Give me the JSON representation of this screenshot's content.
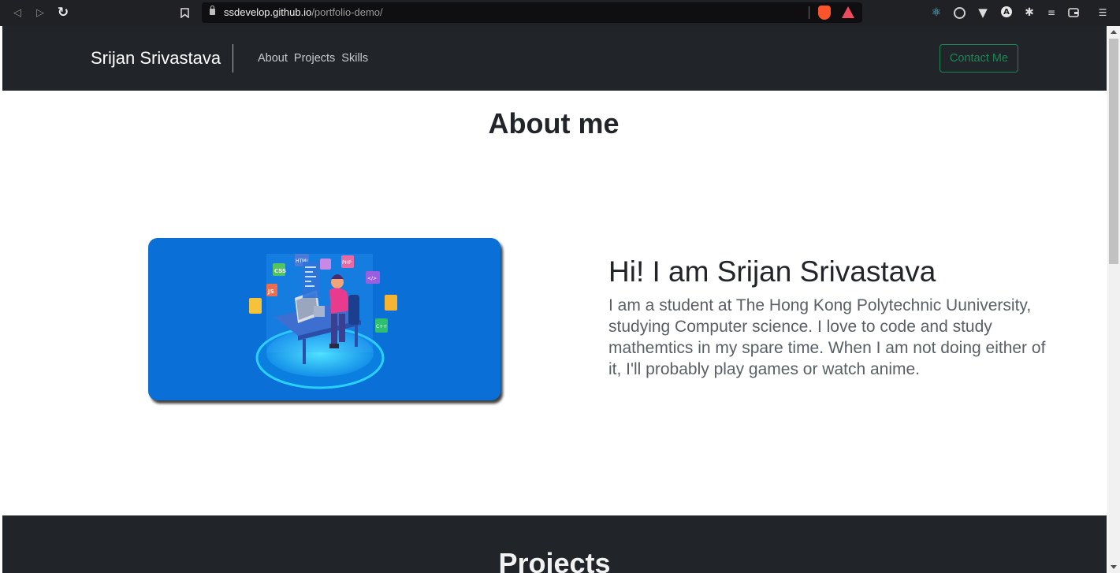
{
  "browser": {
    "url_host": "ssdevelop.github.io",
    "url_path": "/portfolio-demo/",
    "back_icon": "back-arrow-icon",
    "forward_icon": "forward-arrow-icon",
    "reload_icon": "reload-icon",
    "extensions": [
      "react-devtools-icon",
      "target-icon",
      "vue-icon",
      "a-badge-icon",
      "puzzle-icon",
      "reading-list-icon",
      "wallet-icon",
      "menu-icon"
    ]
  },
  "navbar": {
    "brand": "Srijan Srivastava",
    "links": [
      "About",
      "Projects",
      "Skills"
    ],
    "contact_label": "Contact Me",
    "accent_color": "#198754",
    "background": "#212529"
  },
  "about": {
    "title": "About me",
    "greeting": "Hi! I am Srijan Srivastava",
    "bio": "I am a student at The Hong Kong Polytechnic Uuniversity, studying Computer science. I love to code and study mathemtics in my spare time. When I am not doing either of it, I'll probably play games or watch anime.",
    "image_tags": [
      "CSS",
      "HTML",
      "JS",
      "PHP",
      "</>",
      "C++",
      "{ }"
    ]
  },
  "projects": {
    "title": "Projects"
  }
}
